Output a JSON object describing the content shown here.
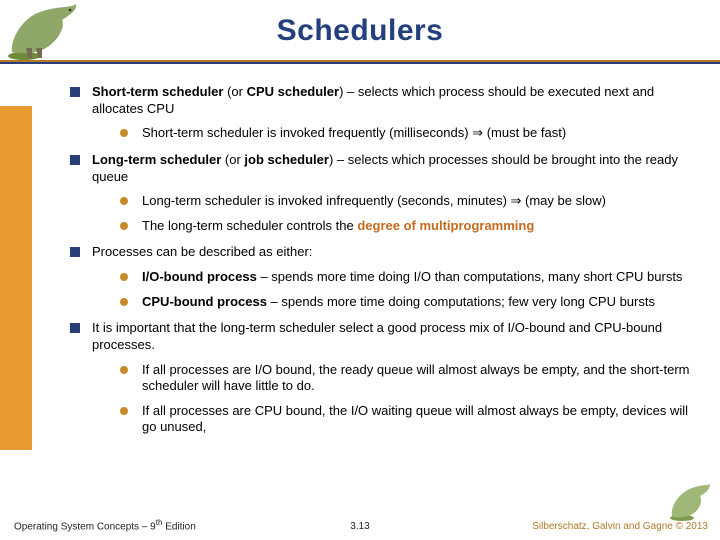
{
  "title": "Schedulers",
  "bullets": {
    "b1_prefix": "Short-term scheduler",
    "b1_mid": "  (or ",
    "b1_bold2": "CPU scheduler",
    "b1_rest": ") – selects which process should be executed next and allocates CPU",
    "b1s1": "Short-term scheduler is invoked frequently (milliseconds) ⇒ (must be fast)",
    "b2_prefix": "Long-term scheduler",
    "b2_mid": "  (or ",
    "b2_bold2": "job scheduler",
    "b2_rest": ") – selects which processes should be brought into the ready queue",
    "b2s1": "Long-term scheduler is invoked  infrequently (seconds, minutes) ⇒ (may be slow)",
    "b2s2_a": "The long-term scheduler controls the ",
    "b2s2_em": "degree of multiprogramming",
    "b3": "Processes can be described as either:",
    "b3s1_bold": "I/O-bound process",
    "b3s1_rest": " – spends more time doing I/O than computations, many short CPU bursts",
    "b3s2_bold": "CPU-bound process",
    "b3s2_rest": " – spends more time doing computations; few very long CPU bursts",
    "b4": "It is important that the long-term scheduler select a good process mix of I/O-bound and CPU-bound processes.",
    "b4s1": "If all processes are I/O bound, the ready queue will almost always be empty, and the short-term scheduler will have little to do.",
    "b4s2": "If all processes are CPU bound, the I/O waiting queue will almost always be empty, devices will go unused,"
  },
  "footer": {
    "left_a": "Operating System Concepts – 9",
    "left_sup": "th",
    "left_b": " Edition",
    "center": "3.13",
    "right": "Silberschatz, Galvin and Gagne © 2013"
  }
}
